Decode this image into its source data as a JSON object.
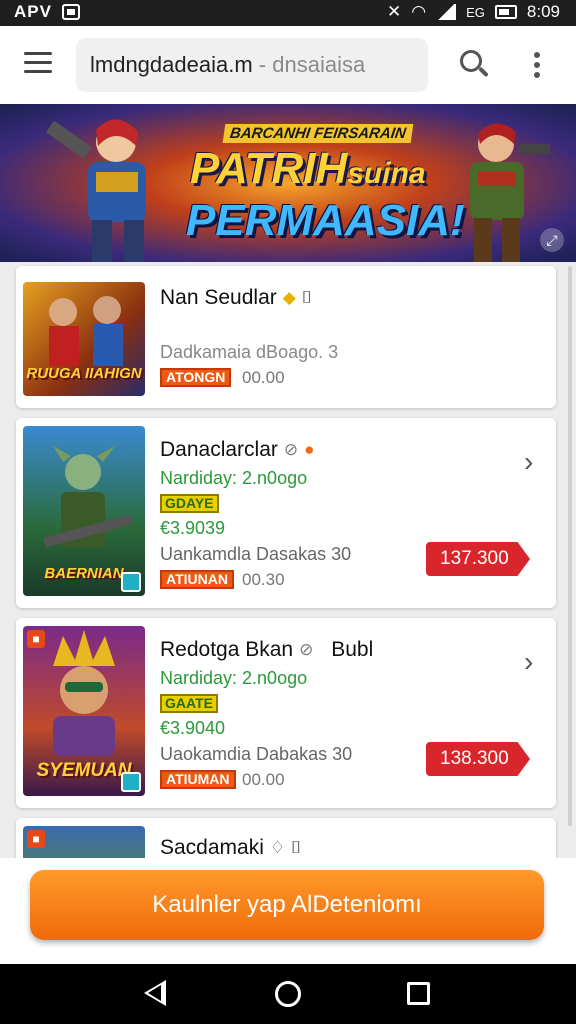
{
  "status_bar": {
    "left_text": "APV",
    "time": "8:09",
    "icons": [
      "image-icon",
      "mute-icon",
      "wifi-icon",
      "signal-icon",
      "battery-icon"
    ],
    "network_label": "EG"
  },
  "browser": {
    "url_main": "lmdngdadeaia.m",
    "url_muted": "- dnsaiaisa",
    "icons": [
      "menu-icon",
      "search-icon",
      "more-icon"
    ]
  },
  "banner": {
    "subtitle": "BARCANHI FEIRSARAIN",
    "title_line1": "PATRIH",
    "title_line1_suffix": "suina",
    "title_line2": "PERMAASIA!"
  },
  "cards": [
    {
      "name": "Nan Seudlar",
      "name_icons": [
        "diamond-icon",
        "shield-outline-icon"
      ],
      "sub": "Dadkamaia dBoago. 3",
      "tag": "ATONGN",
      "value": "00.00",
      "thumb_label": "RUUGA IIAHIGN"
    },
    {
      "name": "Danaclarclar",
      "name_icons": [
        "verified-icon",
        "pin-icon"
      ],
      "green_line": "Nardiday: 2.n0ogo",
      "yellow_tag": "GDAYE",
      "green_price": "€3.9039",
      "sub": "Uankamdla Dasakas 30",
      "tag": "ATIUNAN",
      "value": "00.30",
      "price": "137.300",
      "thumb_label": "BAERNIAN"
    },
    {
      "name": "Redotga Bkan",
      "name_extra": "Bubl",
      "name_icons": [
        "verified-icon"
      ],
      "green_line": "Nardiday: 2.n0ogo",
      "yellow_tag": "GAATE",
      "green_price": "€3.9040",
      "sub": "Uaokamdia Dabakas 30",
      "tag": "ATIUMAN",
      "value": "00.00",
      "price": "138.300",
      "thumb_label": "SYEMUAN"
    },
    {
      "name": "Sacdamaki",
      "name_icons": [
        "pin-outline-icon",
        "shield-outline-icon"
      ]
    }
  ],
  "cta": {
    "label": "Kaulnler yap AlDeteniomı"
  },
  "nav": {
    "icons": [
      "back-icon",
      "home-icon",
      "recents-icon"
    ]
  }
}
